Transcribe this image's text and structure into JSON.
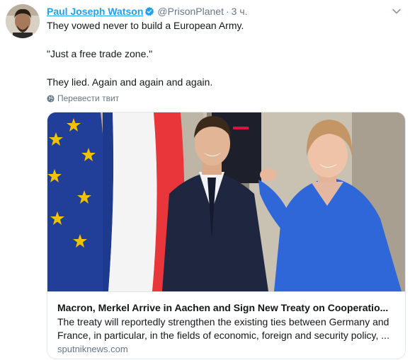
{
  "author": {
    "name": "Paul Joseph Watson",
    "handle": "@PrisonPlanet",
    "separator": "·",
    "time": "3 ч."
  },
  "tweet": {
    "lines": [
      "They vowed never to build a European Army.",
      "\"Just a free trade zone.\"",
      "They lied. Again and again and again."
    ]
  },
  "translate_label": "Перевести твит",
  "card": {
    "title": "Macron, Merkel Arrive in Aachen and Sign New Treaty on Cooperatio...",
    "description_lines": [
      "The treaty will reportedly strengthen the existing ties between Germany and",
      "France, in particular, in the fields of economic, foreign and security policy, ..."
    ],
    "domain": "sputniknews.com"
  },
  "colors": {
    "link_blue": "#1da1f2",
    "secondary_gray": "#657786",
    "border": "#e1e8ed",
    "eu_blue": "#1f3f9c",
    "eu_star": "#f2c200",
    "merkel_jacket": "#2f66d8"
  },
  "icons": {
    "verified": "verified-badge-icon",
    "caret": "chevron-down-icon",
    "translate": "globe-icon"
  }
}
